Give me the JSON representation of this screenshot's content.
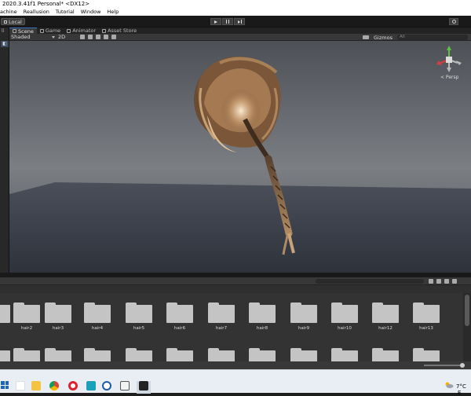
{
  "window": {
    "title": "2020.3.41f1 Personal* <DX12>"
  },
  "menu": [
    "achine",
    "Reallusion",
    "Tutorial",
    "Window",
    "Help"
  ],
  "toolbar": {
    "local_label": "Local"
  },
  "tabs": [
    "Scene",
    "Game",
    "Animator",
    "Asset Store"
  ],
  "scene_toolbar": {
    "shading_mode": "Shaded",
    "toggle_2d": "2D",
    "gizmos_label": "Gizmos",
    "search_placeholder": "All"
  },
  "left_panel": {
    "label": "li"
  },
  "viewport": {
    "projection_label": "< Persp"
  },
  "assets_row1": [
    "hair2",
    "hair3",
    "hair4",
    "hair5",
    "hair6",
    "hair7",
    "hair8",
    "hair9",
    "hair10",
    "hair12",
    "hair13"
  ],
  "taskbar": {
    "icons": [
      "start-icon",
      "file-explorer-icon",
      "chrome-icon",
      "opera-icon",
      "app-m-icon",
      "app-c-icon",
      "unity-hub-icon",
      "unity-icon"
    ],
    "temperature": "7°C",
    "clock_fragment": "E"
  },
  "colors": {
    "accent": "#3a79c8",
    "viewport_sky": "#666a70",
    "floor": "#3a3e48"
  }
}
